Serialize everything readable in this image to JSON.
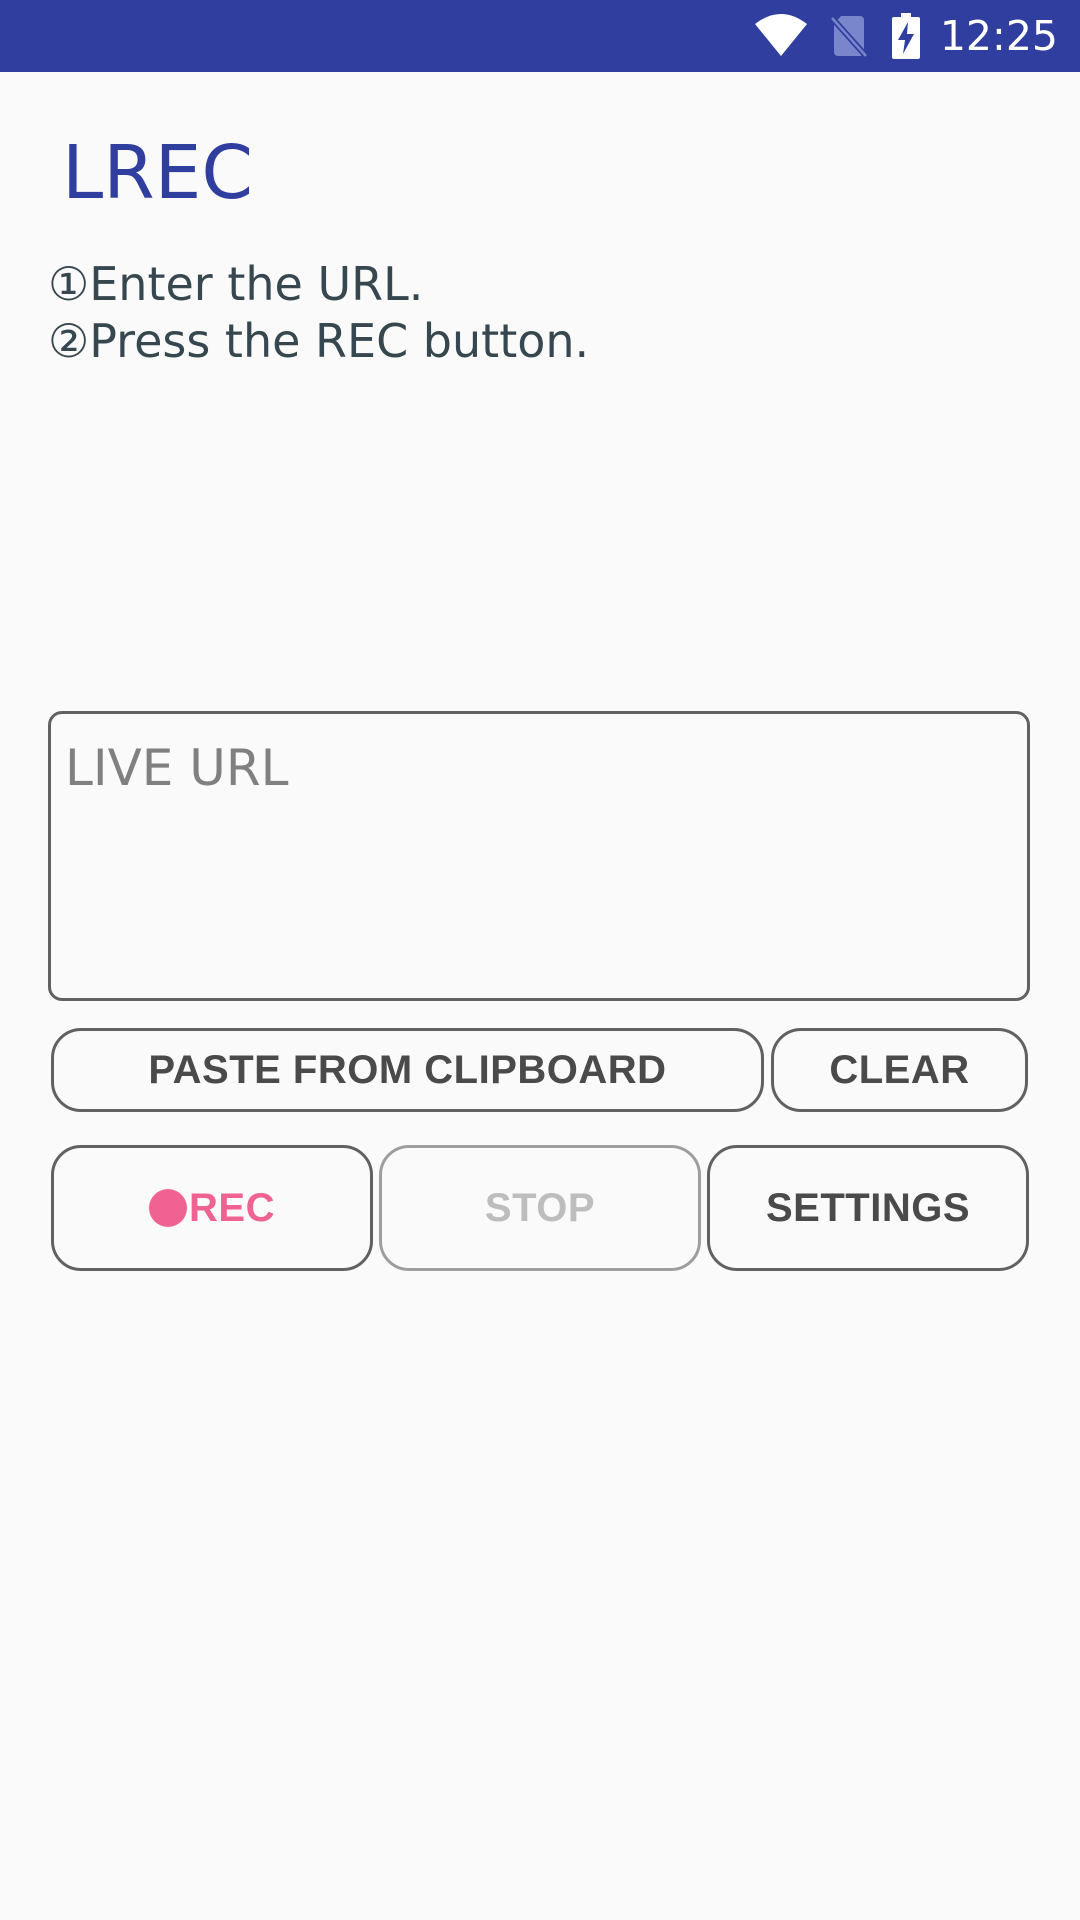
{
  "status_bar": {
    "time": "12:25",
    "icons": [
      "wifi-icon",
      "no-sim-icon",
      "battery-charging-icon"
    ]
  },
  "app": {
    "title": "LREC"
  },
  "instructions": {
    "step1": "①Enter the URL.",
    "step2": "②Press the REC button."
  },
  "url_input": {
    "placeholder": "LIVE URL",
    "value": ""
  },
  "buttons": {
    "paste_label": "PASTE FROM CLIPBOARD",
    "clear_label": "CLEAR",
    "rec_label": "REC",
    "stop_label": "STOP",
    "settings_label": "SETTINGS"
  },
  "colors": {
    "primary": "#303f9f",
    "rec_accent": "#f06292",
    "disabled_text": "#bdbdbd"
  }
}
